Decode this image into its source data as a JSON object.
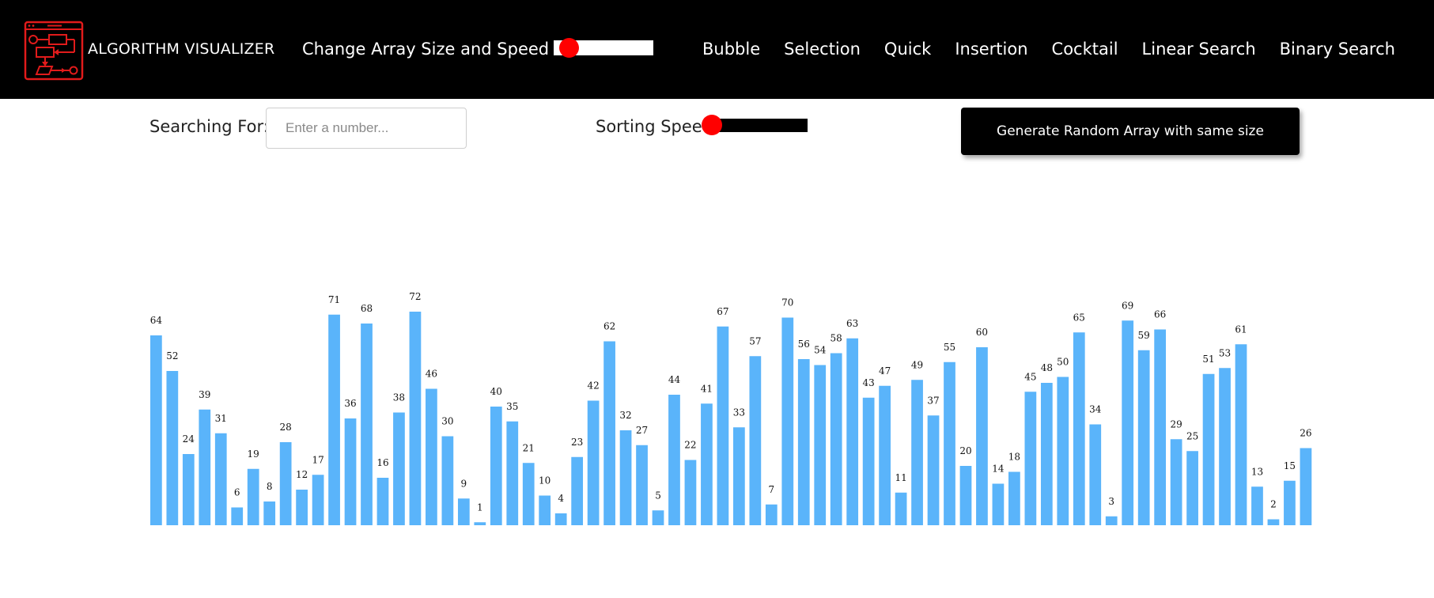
{
  "header": {
    "brand": "ALGORITHM VISUALIZER",
    "size_label": "Change Array Size and Speed",
    "nav": [
      "Bubble",
      "Selection",
      "Quick",
      "Insertion",
      "Cocktail",
      "Linear Search",
      "Binary Search"
    ]
  },
  "controls": {
    "search_label": "Searching For:",
    "search_placeholder": "Enter a number...",
    "speed_label": "Sorting Speed",
    "generate_button": "Generate Random Array with same size"
  },
  "sliders": {
    "size_level": 0.15,
    "speed_level": 0.02
  },
  "colors": {
    "bar": "#5ab4fa",
    "header_bg": "#000000",
    "accent": "#ff0000"
  },
  "chart_data": {
    "type": "bar",
    "values": [
      64,
      52,
      24,
      39,
      31,
      6,
      19,
      8,
      28,
      12,
      17,
      71,
      36,
      68,
      16,
      38,
      72,
      46,
      30,
      9,
      1,
      40,
      35,
      21,
      10,
      4,
      23,
      42,
      62,
      32,
      27,
      5,
      44,
      22,
      41,
      67,
      33,
      57,
      7,
      70,
      56,
      54,
      58,
      63,
      43,
      47,
      11,
      49,
      37,
      55,
      20,
      60,
      14,
      18,
      45,
      48,
      50,
      65,
      34,
      3,
      69,
      59,
      66,
      29,
      25,
      51,
      53,
      61,
      13,
      2,
      15,
      26
    ],
    "ylim": [
      0,
      72
    ]
  }
}
